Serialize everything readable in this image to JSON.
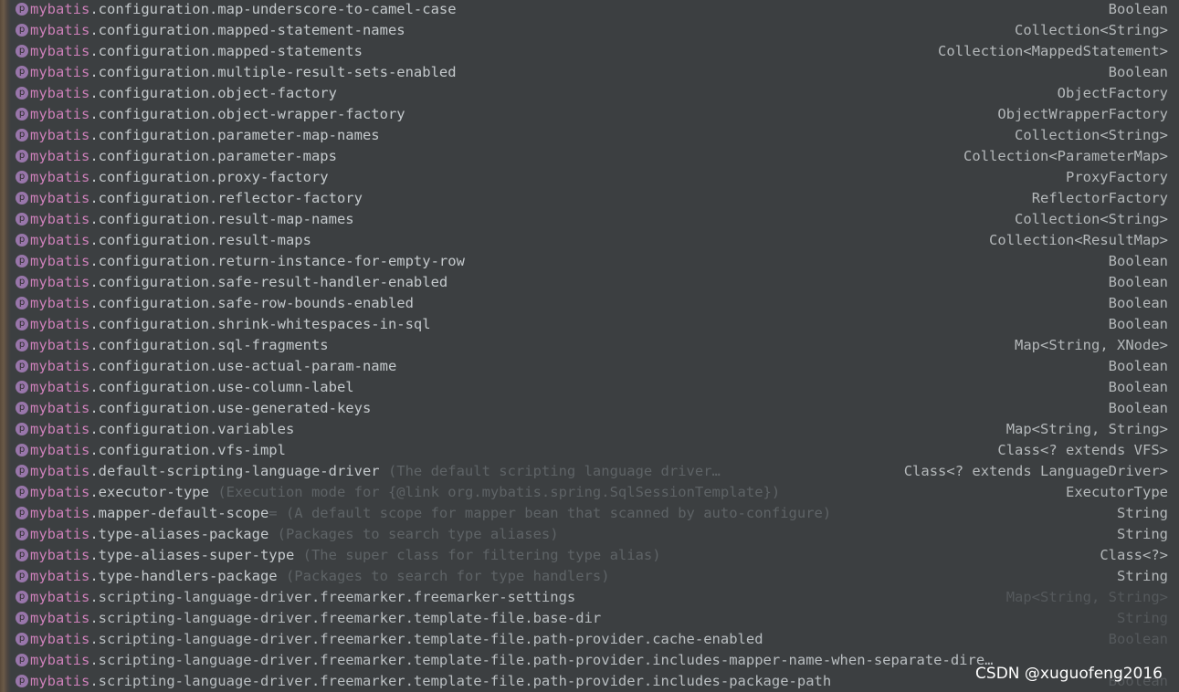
{
  "icon_letter": "p",
  "prefix": "mybatis",
  "watermark": "CSDN @xuguofeng2016",
  "rows": [
    {
      "rest": ".configuration.map-underscore-to-camel-case",
      "desc": "",
      "type": "Boolean",
      "dim": false
    },
    {
      "rest": ".configuration.mapped-statement-names",
      "desc": "",
      "type": "Collection<String>",
      "dim": false
    },
    {
      "rest": ".configuration.mapped-statements",
      "desc": "",
      "type": "Collection<MappedStatement>",
      "dim": false
    },
    {
      "rest": ".configuration.multiple-result-sets-enabled",
      "desc": "",
      "type": "Boolean",
      "dim": false
    },
    {
      "rest": ".configuration.object-factory",
      "desc": "",
      "type": "ObjectFactory",
      "dim": false
    },
    {
      "rest": ".configuration.object-wrapper-factory",
      "desc": "",
      "type": "ObjectWrapperFactory",
      "dim": false
    },
    {
      "rest": ".configuration.parameter-map-names",
      "desc": "",
      "type": "Collection<String>",
      "dim": false
    },
    {
      "rest": ".configuration.parameter-maps",
      "desc": "",
      "type": "Collection<ParameterMap>",
      "dim": false
    },
    {
      "rest": ".configuration.proxy-factory",
      "desc": "",
      "type": "ProxyFactory",
      "dim": false
    },
    {
      "rest": ".configuration.reflector-factory",
      "desc": "",
      "type": "ReflectorFactory",
      "dim": false
    },
    {
      "rest": ".configuration.result-map-names",
      "desc": "",
      "type": "Collection<String>",
      "dim": false
    },
    {
      "rest": ".configuration.result-maps",
      "desc": "",
      "type": "Collection<ResultMap>",
      "dim": false
    },
    {
      "rest": ".configuration.return-instance-for-empty-row",
      "desc": "",
      "type": "Boolean",
      "dim": false
    },
    {
      "rest": ".configuration.safe-result-handler-enabled",
      "desc": "",
      "type": "Boolean",
      "dim": false
    },
    {
      "rest": ".configuration.safe-row-bounds-enabled",
      "desc": "",
      "type": "Boolean",
      "dim": false
    },
    {
      "rest": ".configuration.shrink-whitespaces-in-sql",
      "desc": "",
      "type": "Boolean",
      "dim": false
    },
    {
      "rest": ".configuration.sql-fragments",
      "desc": "",
      "type": "Map<String, XNode>",
      "dim": false
    },
    {
      "rest": ".configuration.use-actual-param-name",
      "desc": "",
      "type": "Boolean",
      "dim": false
    },
    {
      "rest": ".configuration.use-column-label",
      "desc": "",
      "type": "Boolean",
      "dim": false
    },
    {
      "rest": ".configuration.use-generated-keys",
      "desc": "",
      "type": "Boolean",
      "dim": false
    },
    {
      "rest": ".configuration.variables",
      "desc": "",
      "type": "Map<String, String>",
      "dim": false
    },
    {
      "rest": ".configuration.vfs-impl",
      "desc": "",
      "type": "Class<? extends VFS>",
      "dim": false
    },
    {
      "rest": ".default-scripting-language-driver",
      "desc": " (The default scripting language driver…",
      "type": "Class<? extends LanguageDriver>",
      "dim": false
    },
    {
      "rest": ".executor-type",
      "desc": " (Execution mode for {@link org.mybatis.spring.SqlSessionTemplate})",
      "type": "ExecutorType",
      "dim": false
    },
    {
      "rest": ".mapper-default-scope",
      "desc": "= (A default scope for mapper bean that scanned by auto-configure)",
      "type": "String",
      "dim": false
    },
    {
      "rest": ".type-aliases-package",
      "desc": " (Packages to search type aliases)",
      "type": "String",
      "dim": false
    },
    {
      "rest": ".type-aliases-super-type",
      "desc": " (The super class for filtering type alias)",
      "type": "Class<?>",
      "dim": false
    },
    {
      "rest": ".type-handlers-package",
      "desc": " (Packages to search for type handlers)",
      "type": "String",
      "dim": false
    },
    {
      "rest": ".scripting-language-driver.freemarker.freemarker-settings",
      "desc": "",
      "type": "Map<String, String>",
      "dim": true
    },
    {
      "rest": ".scripting-language-driver.freemarker.template-file.base-dir",
      "desc": "",
      "type": "String",
      "dim": true
    },
    {
      "rest": ".scripting-language-driver.freemarker.template-file.path-provider.cache-enabled",
      "desc": "",
      "type": "Boolean",
      "dim": true
    },
    {
      "rest": ".scripting-language-driver.freemarker.template-file.path-provider.includes-mapper-name-when-separate-dire…",
      "desc": "",
      "type": "",
      "dim": true
    },
    {
      "rest": ".scripting-language-driver.freemarker.template-file.path-provider.includes-package-path",
      "desc": "",
      "type": "Boolean",
      "dim": true
    }
  ]
}
